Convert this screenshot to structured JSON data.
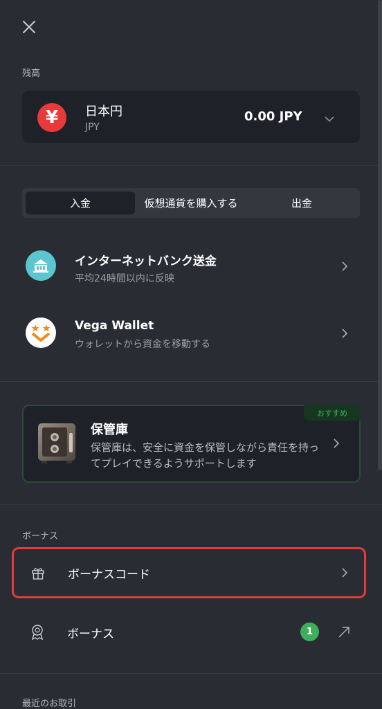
{
  "balance_section": {
    "label": "残高",
    "currency_symbol": "¥",
    "currency_name": "日本円",
    "currency_code": "JPY",
    "amount": "0.00 JPY"
  },
  "tabs": [
    {
      "label": "入金",
      "active": true
    },
    {
      "label": "仮想通貨を購入する",
      "active": false
    },
    {
      "label": "出金",
      "active": false
    }
  ],
  "methods": [
    {
      "title": "インターネットバンク送金",
      "subtitle": "平均24時間以内に反映",
      "icon": "bank-icon"
    },
    {
      "title": "Vega Wallet",
      "subtitle": "ウォレットから資金を移動する",
      "icon": "vega-wallet-icon"
    }
  ],
  "vault": {
    "badge": "おすすめ",
    "title": "保管庫",
    "description": "保管庫は、安全に資金を保管しながら責任を持ってプレイできるようサポートします",
    "icon": "safe-icon"
  },
  "bonus_section": {
    "label": "ボーナス",
    "items": [
      {
        "label": "ボーナスコード",
        "icon": "gift-icon"
      },
      {
        "label": "ボーナス",
        "icon": "award-icon",
        "count": "1"
      }
    ]
  },
  "recent_section": {
    "label": "最近のお取引"
  },
  "colors": {
    "background": "#292d33",
    "card": "#1e2228",
    "accent_green": "#3fae5c",
    "yen_red": "#e83a3a",
    "highlight_red": "#e23b3b",
    "bank_teal": "#5bc6cf"
  }
}
